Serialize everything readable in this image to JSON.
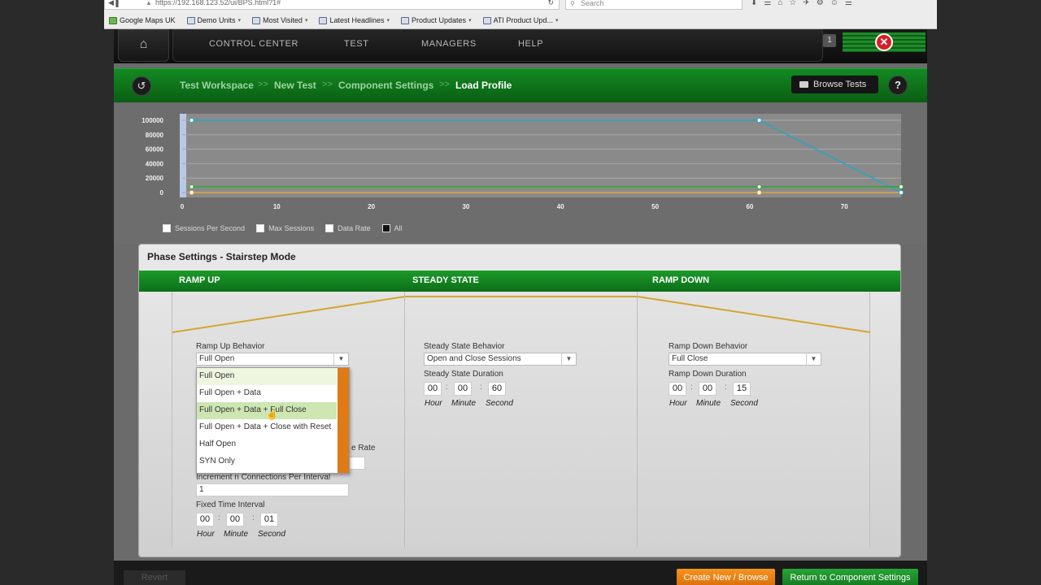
{
  "browser": {
    "url": "https://192.168.123.52/ui/BPS.html?1#",
    "search_placeholder": "Search",
    "bookmarks": [
      {
        "label": "Google Maps UK"
      },
      {
        "label": "Demo Units",
        "caret": "▾"
      },
      {
        "label": "Most Visited",
        "caret": "▾"
      },
      {
        "label": "Latest Headlines",
        "caret": "▾"
      },
      {
        "label": "Product Updates",
        "caret": "▾"
      },
      {
        "label": "ATI Product Upd...",
        "caret": "▾"
      }
    ]
  },
  "topnav": {
    "home_icon": "⌂",
    "items": [
      "CONTROL CENTER",
      "TEST",
      "MANAGERS",
      "HELP"
    ],
    "badge": "1",
    "close_icon": "✕"
  },
  "breadcrumb": {
    "back_icon": "↺",
    "items": [
      "Test Workspace",
      "New Test",
      "Component Settings",
      "Load Profile"
    ],
    "separator": ">>",
    "browse_label": "Browse Tests",
    "help_label": "?"
  },
  "chart_data": {
    "type": "line",
    "x_ticks": [
      0,
      10,
      20,
      30,
      40,
      50,
      60,
      70
    ],
    "y_ticks": [
      0,
      20000,
      40000,
      60000,
      80000,
      100000
    ],
    "xlim": [
      0,
      76
    ],
    "ylim": [
      0,
      100000
    ],
    "grid": true,
    "series": [
      {
        "name": "Sessions Per Second",
        "color": "#e8a640",
        "x": [
          1,
          61,
          76
        ],
        "y": [
          0,
          0,
          0
        ]
      },
      {
        "name": "Max Sessions",
        "color": "#22a8c4",
        "x": [
          1,
          61,
          76
        ],
        "y": [
          100000,
          100000,
          0
        ]
      },
      {
        "name": "Data Rate",
        "color": "#2ea82e",
        "x": [
          1,
          61,
          76
        ],
        "y": [
          8000,
          8000,
          8000
        ]
      }
    ],
    "legend": [
      "Sessions Per Second",
      "Max Sessions",
      "Data Rate",
      "All"
    ],
    "legend_position": "bottom-left"
  },
  "phase": {
    "title": "Phase Settings - Stairstep Mode",
    "headers": [
      "RAMP UP",
      "STEADY STATE",
      "RAMP DOWN"
    ],
    "ramp_up": {
      "behavior_label": "Ramp Up Behavior",
      "behavior_value": "Full Open",
      "hidden_label_fragment": "e Rate",
      "increment_label": "Increment n Connections Per Interval",
      "increment_value": "1",
      "interval_label": "Fixed Time Interval",
      "hour": "00",
      "minute": "00",
      "second": "01"
    },
    "steady": {
      "behavior_label": "Steady State Behavior",
      "behavior_value": "Open and Close Sessions",
      "duration_label": "Steady State Duration",
      "hour": "00",
      "minute": "00",
      "second": "60"
    },
    "ramp_down": {
      "behavior_label": "Ramp Down Behavior",
      "behavior_value": "Full Close",
      "duration_label": "Ramp Down Duration",
      "hour": "00",
      "minute": "00",
      "second": "15"
    },
    "units": {
      "hour": "Hour",
      "minute": "Minute",
      "second": "Second"
    },
    "dropdown_options": [
      "Full Open",
      "Full Open + Data",
      "Full Open + Data + Full Close",
      "Full Open + Data + Close with Reset",
      "Half Open",
      "SYN Only"
    ]
  },
  "bottom": {
    "revert": "Revert",
    "create": "Create New / Browse",
    "return": "Return to Component Settings"
  },
  "colors": {
    "accent_green": "#1b9a2a",
    "orange": "#e07a17",
    "profile_line": "#d4a531"
  }
}
